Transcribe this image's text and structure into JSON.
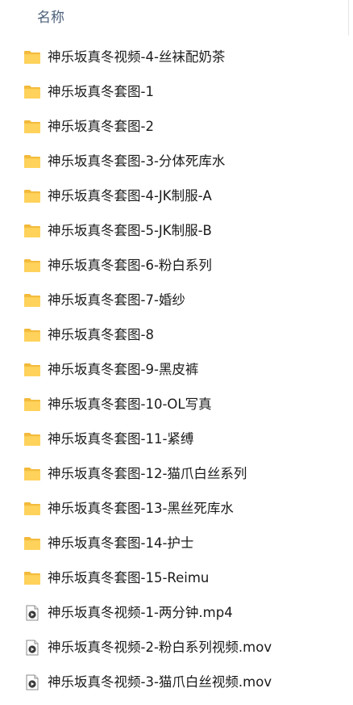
{
  "header": {
    "name_column": "名称"
  },
  "files": [
    {
      "name": "神乐坂真冬视频-4-丝袜配奶茶",
      "type": "folder",
      "icon": "folder-icon"
    },
    {
      "name": "神乐坂真冬套图-1",
      "type": "folder",
      "icon": "folder-icon"
    },
    {
      "name": "神乐坂真冬套图-2",
      "type": "folder",
      "icon": "folder-icon"
    },
    {
      "name": "神乐坂真冬套图-3-分体死库水",
      "type": "folder",
      "icon": "folder-icon"
    },
    {
      "name": "神乐坂真冬套图-4-JK制服-A",
      "type": "folder",
      "icon": "folder-icon"
    },
    {
      "name": "神乐坂真冬套图-5-JK制服-B",
      "type": "folder",
      "icon": "folder-icon"
    },
    {
      "name": "神乐坂真冬套图-6-粉白系列",
      "type": "folder",
      "icon": "folder-icon"
    },
    {
      "name": "神乐坂真冬套图-7-婚纱",
      "type": "folder",
      "icon": "folder-icon"
    },
    {
      "name": "神乐坂真冬套图-8",
      "type": "folder",
      "icon": "folder-icon"
    },
    {
      "name": "神乐坂真冬套图-9-黑皮裤",
      "type": "folder",
      "icon": "folder-icon"
    },
    {
      "name": "神乐坂真冬套图-10-OL写真",
      "type": "folder",
      "icon": "folder-icon"
    },
    {
      "name": "神乐坂真冬套图-11-紧缚",
      "type": "folder",
      "icon": "folder-icon"
    },
    {
      "name": "神乐坂真冬套图-12-猫爪白丝系列",
      "type": "folder",
      "icon": "folder-icon"
    },
    {
      "name": "神乐坂真冬套图-13-黑丝死库水",
      "type": "folder",
      "icon": "folder-icon"
    },
    {
      "name": "神乐坂真冬套图-14-护士",
      "type": "folder",
      "icon": "folder-icon"
    },
    {
      "name": "神乐坂真冬套图-15-Reimu",
      "type": "folder",
      "icon": "folder-icon"
    },
    {
      "name": "神乐坂真冬视频-1-两分钟.mp4",
      "type": "video",
      "icon": "video-file-icon"
    },
    {
      "name": "神乐坂真冬视频-2-粉白系列视频.mov",
      "type": "video",
      "icon": "video-file-icon"
    },
    {
      "name": "神乐坂真冬视频-3-猫爪白丝视频.mov",
      "type": "video",
      "icon": "video-file-icon"
    }
  ],
  "colors": {
    "folder_body": "#ffd25c",
    "folder_back": "#f3b93a",
    "header_text": "#4c607a",
    "file_text": "#1a1a1a"
  }
}
